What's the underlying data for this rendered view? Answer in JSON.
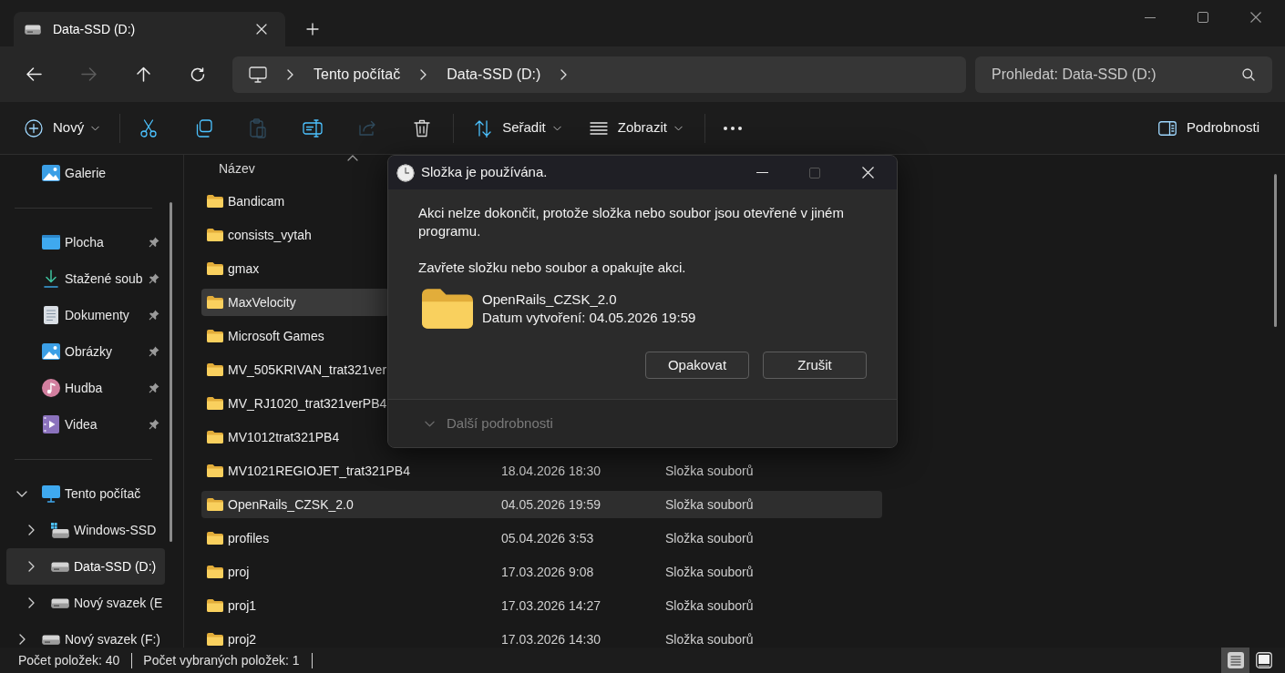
{
  "tabs": [
    {
      "label": "Data-SSD (D:)",
      "selected": true
    }
  ],
  "nav_buttons": [
    {
      "kind": "back",
      "disabled": false
    },
    {
      "kind": "forward",
      "disabled": true
    },
    {
      "kind": "up",
      "disabled": false
    },
    {
      "kind": "refresh",
      "disabled": false
    }
  ],
  "address_bar": {
    "crumbs": [
      "Tento počítač",
      "Data-SSD (D:)"
    ]
  },
  "search": {
    "placeholder": "Prohledat: Data-SSD (D:)"
  },
  "toolbar": {
    "items": [
      {
        "kind": "new",
        "label": "Nový",
        "disabled": false
      },
      {
        "kind": "separator"
      },
      {
        "kind": "cut",
        "disabled": false
      },
      {
        "kind": "copy",
        "disabled": false
      },
      {
        "kind": "paste",
        "disabled": true
      },
      {
        "kind": "rename",
        "disabled": false
      },
      {
        "kind": "share",
        "disabled": true
      },
      {
        "kind": "delete",
        "disabled": false
      },
      {
        "kind": "separator"
      },
      {
        "kind": "sort",
        "label": "Seřadit",
        "disabled": false
      },
      {
        "kind": "view",
        "label": "Zobrazit",
        "disabled": false
      },
      {
        "kind": "separator"
      },
      {
        "kind": "more",
        "disabled": false
      }
    ],
    "details_button": {
      "label": "Podrobnosti"
    }
  },
  "sidebar": {
    "sections": [
      {
        "items": [
          {
            "kind": "gallery",
            "label": "Galerie",
            "selected": false
          }
        ]
      },
      {
        "items": [
          {
            "kind": "desktop",
            "label": "Plocha",
            "pinned": true,
            "selected": false
          },
          {
            "kind": "downloads",
            "label": "Stažené soub",
            "pinned": true,
            "selected": false
          },
          {
            "kind": "documents",
            "label": "Dokumenty",
            "pinned": true,
            "selected": false
          },
          {
            "kind": "pictures",
            "label": "Obrázky",
            "pinned": true,
            "selected": false
          },
          {
            "kind": "music",
            "label": "Hudba",
            "pinned": true,
            "selected": false
          },
          {
            "kind": "videos",
            "label": "Videa",
            "pinned": true,
            "selected": false
          }
        ]
      },
      {
        "items": [
          {
            "kind": "pc",
            "label": "Tento počítač",
            "expanded": true,
            "selected": false,
            "children": [
              {
                "kind": "system_drive",
                "label": "Windows-SSD",
                "expanded": false,
                "selected": false
              },
              {
                "kind": "drive",
                "label": "Data-SSD (D:)",
                "expanded": false,
                "selected": true
              },
              {
                "kind": "drive",
                "label": "Nový svazek (E",
                "expanded": false,
                "selected": false
              }
            ]
          },
          {
            "kind": "drive",
            "label": "Nový svazek (F:)",
            "expanded": false,
            "selected": false
          }
        ]
      }
    ]
  },
  "file_list": {
    "columns": [
      {
        "label": "Název",
        "sorted": true
      }
    ],
    "rows": [
      {
        "name": "Bandicam",
        "selected": false,
        "hovered": false
      },
      {
        "name": "consists_vytah",
        "selected": false,
        "hovered": false
      },
      {
        "name": "gmax",
        "selected": false,
        "hovered": false
      },
      {
        "name": "MaxVelocity",
        "selected": false,
        "hovered": true
      },
      {
        "name": "Microsoft Games",
        "selected": false,
        "hovered": false
      },
      {
        "name": "MV_505KRIVAN_trat321ver",
        "selected": false,
        "hovered": false
      },
      {
        "name": "MV_RJ1020_trat321verPB4",
        "selected": false,
        "hovered": false
      },
      {
        "name": "MV1012trat321PB4",
        "selected": false,
        "hovered": false
      },
      {
        "name": "MV1021REGIOJET_trat321PB4",
        "date": "18.04.2026 18:30",
        "type": "Složka souborů",
        "selected": false,
        "hovered": false
      },
      {
        "name": "OpenRails_CZSK_2.0",
        "date": "04.05.2026 19:59",
        "type": "Složka souborů",
        "selected": true,
        "hovered": false
      },
      {
        "name": "profiles",
        "date": "05.04.2026 3:53",
        "type": "Složka souborů",
        "selected": false,
        "hovered": false
      },
      {
        "name": "proj",
        "date": "17.03.2026 9:08",
        "type": "Složka souborů",
        "selected": false,
        "hovered": false
      },
      {
        "name": "proj1",
        "date": "17.03.2026 14:27",
        "type": "Složka souborů",
        "selected": false,
        "hovered": false
      },
      {
        "name": "proj2",
        "date": "17.03.2026 14:30",
        "type": "Složka souborů",
        "selected": false,
        "hovered": false
      }
    ]
  },
  "dialog": {
    "title": "Složka je používána.",
    "title_buttons": [
      {
        "kind": "minimize",
        "disabled": false
      },
      {
        "kind": "maximize",
        "disabled": true
      },
      {
        "kind": "close",
        "disabled": false
      }
    ],
    "message": "Akci nelze dokončit, protože složka nebo soubor jsou otevřené v jiném programu.",
    "instruction": "Zavřete složku nebo soubor a opakujte akci.",
    "item": {
      "name": "OpenRails_CZSK_2.0",
      "detail": "Datum vytvoření: 04.05.2026 19:59"
    },
    "buttons": [
      "Opakovat",
      "Zrušit"
    ],
    "details_toggle": {
      "label": "Další podrobnosti",
      "disabled": true,
      "expanded": false
    }
  },
  "status_bar": {
    "texts": [
      "Počet položek: 40",
      "Počet vybraných položek: 1"
    ],
    "views": [
      {
        "kind": "details",
        "selected": true
      },
      {
        "kind": "tiles",
        "selected": false
      }
    ]
  }
}
